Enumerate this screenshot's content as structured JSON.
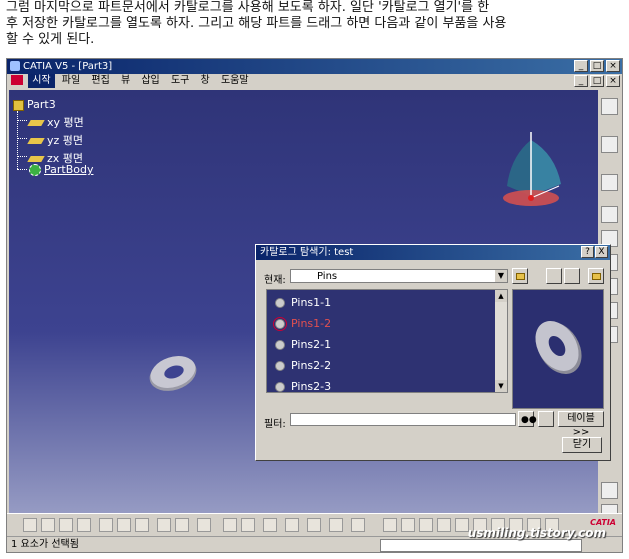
{
  "article": {
    "line1": "그럼 마지막으로 파트문서에서 카탈로그를 사용해 보도록 하자. 일단 '카탈로그 열기'를 한",
    "line2": "후 저장한 카탈로그를 열도록 하자. 그리고 해당 파트를 드래그 하면 다음과 같이 부품을 사용",
    "line3": "할 수 있게 된다."
  },
  "window": {
    "title": "CATIA V5 - [Part3]"
  },
  "menu": {
    "items": [
      "시작",
      "파일",
      "편집",
      "뷰",
      "삽입",
      "도구",
      "창",
      "도움말"
    ]
  },
  "tree": {
    "root": "Part3",
    "planes": [
      "xy 평면",
      "yz 평면",
      "zx 평면"
    ],
    "partbody": "PartBody"
  },
  "dialog": {
    "title": "카탈로그 탐색기: test",
    "current_label": "현재:",
    "current_value": "Pins",
    "items": [
      "Pins1-1",
      "Pins1-2",
      "Pins2-1",
      "Pins2-2",
      "Pins2-3"
    ],
    "selected_index": 1,
    "filter_label": "필터:",
    "filter_value": "",
    "table_button": "테이블>>",
    "close_button": "닫기",
    "help_button": "?",
    "close_x": "X"
  },
  "status": {
    "text": "1 요소가 선택됨"
  },
  "watermark": "usmiling.tistory.com",
  "colors": {
    "title_bar": "#0a246a",
    "viewport": "#2f3478",
    "selected_item": "#e05050"
  }
}
